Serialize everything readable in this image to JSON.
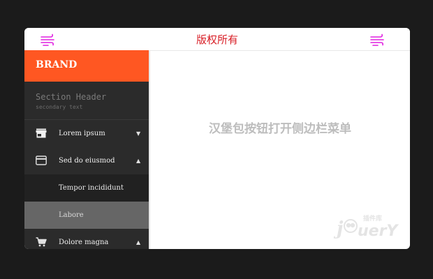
{
  "topbar": {
    "title": "版权所有",
    "left_icon": "hamburger-menu-icon",
    "right_icon": "hamburger-menu-icon",
    "icon_color": "#e020e0",
    "title_color": "#d81e26"
  },
  "sidebar": {
    "brand": "BRAND",
    "brand_color": "#ff5722",
    "section_title": "Section Header",
    "section_subtitle": "secondary text",
    "items": [
      {
        "label": "Lorem ipsum",
        "icon": "store-icon",
        "expanded": false
      },
      {
        "label": "Sed do eiusmod",
        "icon": "credit-card-icon",
        "expanded": true,
        "children": [
          {
            "label": "Tempor incididunt",
            "active": false
          },
          {
            "label": "Labore",
            "active": true
          }
        ]
      },
      {
        "label": "Dolore magna",
        "icon": "shopping-cart-icon",
        "expanded": true
      }
    ]
  },
  "main": {
    "message": "汉堡包按钮打开侧边栏菜单"
  },
  "watermark": {
    "logo_name": "jquery-logo",
    "text": "jQuery",
    "subtext": "插件库"
  }
}
